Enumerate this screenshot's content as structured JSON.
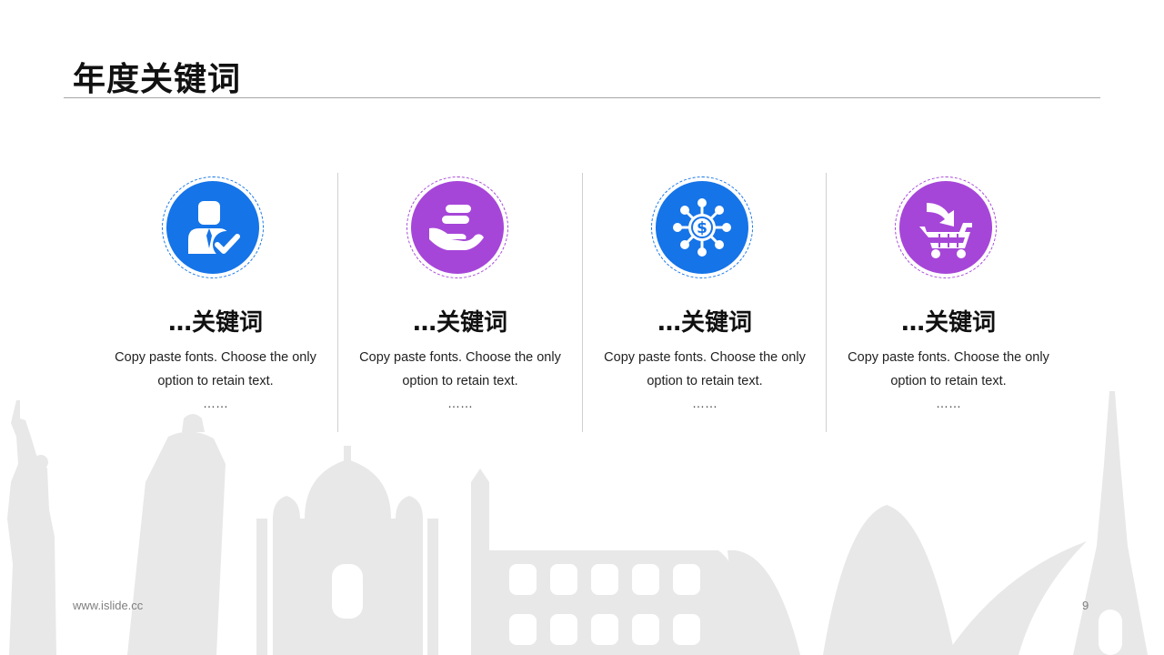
{
  "slide": {
    "title": "年度关键词",
    "footer_url": "www.islide.cc",
    "page_number": "9"
  },
  "colors": {
    "blue": "#1574e8",
    "purple": "#a646d8",
    "rule": "#a6a6a6",
    "skyline": "#e6e6e6"
  },
  "items": [
    {
      "icon": "businessman-check-icon",
      "color": "#1574e8",
      "keyword": "…关键词",
      "desc_line1": "Copy paste fonts. Choose the only",
      "desc_line2": "option to retain text.",
      "ellipsis": "……"
    },
    {
      "icon": "hand-holding-coins-icon",
      "color": "#a646d8",
      "keyword": "…关键词",
      "desc_line1": "Copy paste fonts. Choose the only",
      "desc_line2": "option to retain text.",
      "ellipsis": "……"
    },
    {
      "icon": "dollar-network-icon",
      "color": "#1574e8",
      "keyword": "…关键词",
      "desc_line1": "Copy paste fonts. Choose the only",
      "desc_line2": "option to retain text.",
      "ellipsis": "……"
    },
    {
      "icon": "shopping-cart-icon",
      "color": "#a646d8",
      "keyword": "…关键词",
      "desc_line1": "Copy paste fonts. Choose the only",
      "desc_line2": "option to retain text.",
      "ellipsis": "……"
    }
  ]
}
